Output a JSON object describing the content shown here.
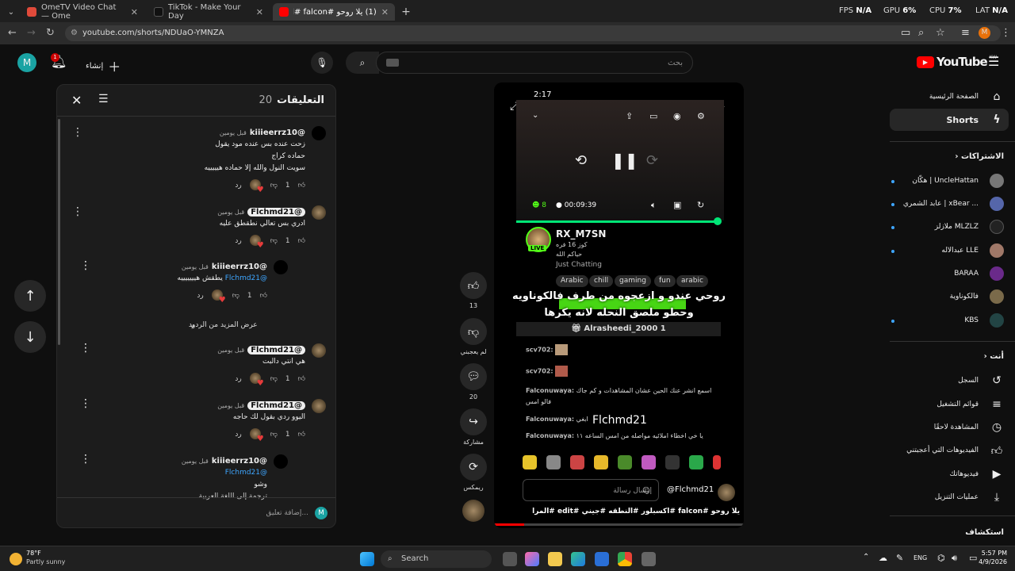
{
  "browser": {
    "tabs": [
      {
        "title": "OmeTV Video Chat — Ome",
        "color": "#e04a3a"
      },
      {
        "title": "TikTok - Make Your Day",
        "color": "#111111"
      },
      {
        "title": "(1) يلا روحو #falcon #اكسبلور",
        "color": "#ff0000"
      }
    ],
    "new_tab": "+",
    "url": "youtube.com/shorts/NDUaO-YMNZA",
    "perf": {
      "fps_label": "FPS",
      "fps": "N/A",
      "gpu_label": "GPU",
      "gpu": "6%",
      "cpu_label": "CPU",
      "cpu": "7%",
      "lat_label": "LAT",
      "lat": "N/A"
    },
    "profile": "M"
  },
  "header": {
    "logo": "YouTube",
    "country": "KW",
    "search_placeholder": "بحث",
    "create_label": "إنشاء",
    "notif_count": "1",
    "avatar": "M"
  },
  "comments": {
    "title": "التعليقات",
    "count": "20",
    "items": [
      {
        "user": "@kiiieerrz10",
        "time": "قبل يومين",
        "text": "زحت عنده بس عنده مود يقول\nحماده كراج\nسويت النول والله إلا حماده هيييييه",
        "likes": "1",
        "reply": "رد",
        "tag": false
      },
      {
        "user": "@Flchmd21",
        "time": "قبل يومين",
        "text": "ادري بس تعالي نطقطق عليه",
        "likes": "1",
        "reply": "رد",
        "tag": true
      },
      {
        "user": "@kiiieerrz10",
        "time": "قبل يومين",
        "mention": "@Flchmd21",
        "text": "يطقش هيييييييه",
        "likes": "1",
        "reply": "رد",
        "tag": false
      },
      {
        "user": "@Flchmd21",
        "time": "قبل يومين",
        "text": "هي انتي دالبت",
        "likes": "1",
        "reply": "رد",
        "tag": true
      },
      {
        "user": "@Flchmd21",
        "time": "قبل يومين",
        "text": "اليوو ردي بقول لك حاجه",
        "likes": "1",
        "reply": "رد",
        "tag": true
      },
      {
        "user": "@kiiieerrz10",
        "time": "قبل يومين",
        "mention": "@Flchmd21",
        "text": "وشو",
        "likes": "",
        "reply": "",
        "tag": false
      }
    ],
    "more_replies": "عرض المزيد من الردود",
    "translate": "ترجمة إلى اللغة العربية",
    "add_placeholder": "إضافة تعليق...",
    "my_avatar": "M"
  },
  "video": {
    "time": "2:17",
    "viewers": "8",
    "duration": "00:09:39",
    "streamer": "RX_M7SN",
    "sub1": "كوز 16 فره",
    "sub2": "حياكم الله",
    "category": "Just Chatting",
    "live": "LIVE",
    "chips": [
      "Arabic",
      "chill",
      "gaming",
      "fun",
      "arabic"
    ],
    "caption1": "روحي عندو و ازعجوه من طرف فالكوناويه",
    "caption2": "وحطو ملصق النحله لانه يكرها",
    "gift_user": "Alrasheedi_2000",
    "gift_count": "1",
    "chat": [
      {
        "user": "scv702:",
        "text": ""
      },
      {
        "user": "scv702:",
        "text": ""
      },
      {
        "user": "Falconuwaya:",
        "text": "اسمع انشر عنك الحين عشان المشاهدات و كم جاك"
      },
      {
        "user": "",
        "text": "فالو امس"
      },
      {
        "user": "Falconuwaya:",
        "text": "ابغي"
      },
      {
        "user": "Falconuwaya:",
        "text": "يا خي اخطاء املائيه مواصله من امس الساعه ١١"
      }
    ],
    "overlay_name": "Flchmd21",
    "msg_placeholder": "إرسال رسالة",
    "channel": "@Flchmd21",
    "title": "يلا روحو #falcon #اكسبلور #النطقه #جيني #edit #المراه #فالكون ..."
  },
  "actions": {
    "likes": "13",
    "dislike": "لم يعجبني",
    "comments": "20",
    "share": "مشاركة",
    "remix": "ريمكس"
  },
  "sidebar": {
    "home": "الصفحة الرئيسية",
    "shorts": "Shorts",
    "subs_title": "الاشتراكات",
    "subs": [
      {
        "name": "هكّان | UncleHattan",
        "color": "#777"
      },
      {
        "name": "عابد الشمري | xBear ...",
        "color": "#5566aa"
      },
      {
        "name": "ملازلز MLZLZ",
        "color": "#222"
      },
      {
        "name": "عبدالاله LLE",
        "color": "#a07868"
      },
      {
        "name": "BARAA",
        "color": "#6a2a8a"
      },
      {
        "name": "فالكوناوية",
        "color": "#7a6a4a"
      },
      {
        "name": "KBS",
        "color": "#224444"
      }
    ],
    "you_title": "أنت",
    "you": [
      {
        "label": "السجل",
        "icon": "history-icon"
      },
      {
        "label": "قوائم التشغيل",
        "icon": "playlist-icon"
      },
      {
        "label": "المشاهدة لاحقًا",
        "icon": "clock-icon"
      },
      {
        "label": "الفيديوهات التي أعجبتني",
        "icon": "thumb-up-icon"
      },
      {
        "label": "فيديوهاتك",
        "icon": "play-icon"
      },
      {
        "label": "عمليات التنزيل",
        "icon": "download-icon"
      }
    ],
    "explore": "استكشاف"
  },
  "taskbar": {
    "temp": "78°F",
    "weather": "Partly sunny",
    "search": "Search",
    "lang": "ENG",
    "time": "5:57 PM",
    "date": "4/9/2026"
  }
}
